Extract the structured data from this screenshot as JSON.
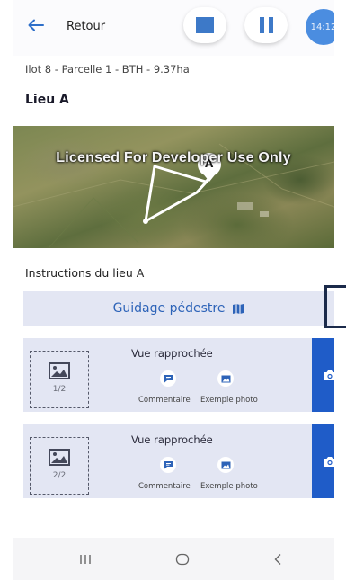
{
  "header": {
    "back_label": "Retour",
    "timer": "14:12",
    "accent_color": "#3d79c8"
  },
  "location": {
    "subtitle": "Ilot 8 - Parcelle 1 - BTH - 9.37ha",
    "title": "Lieu A",
    "map_watermark": "Licensed For Developer Use Only",
    "map_marker_label": "A"
  },
  "instructions": {
    "label": "Instructions du lieu A",
    "guide_button": "Guidage pédestre"
  },
  "photo_cards": [
    {
      "title": "Vue rapprochée",
      "count": "1/2",
      "comment_label": "Commentaire",
      "example_label": "Exemple photo"
    },
    {
      "title": "Vue rapprochée",
      "count": "2/2",
      "comment_label": "Commentaire",
      "example_label": "Exemple photo"
    }
  ]
}
